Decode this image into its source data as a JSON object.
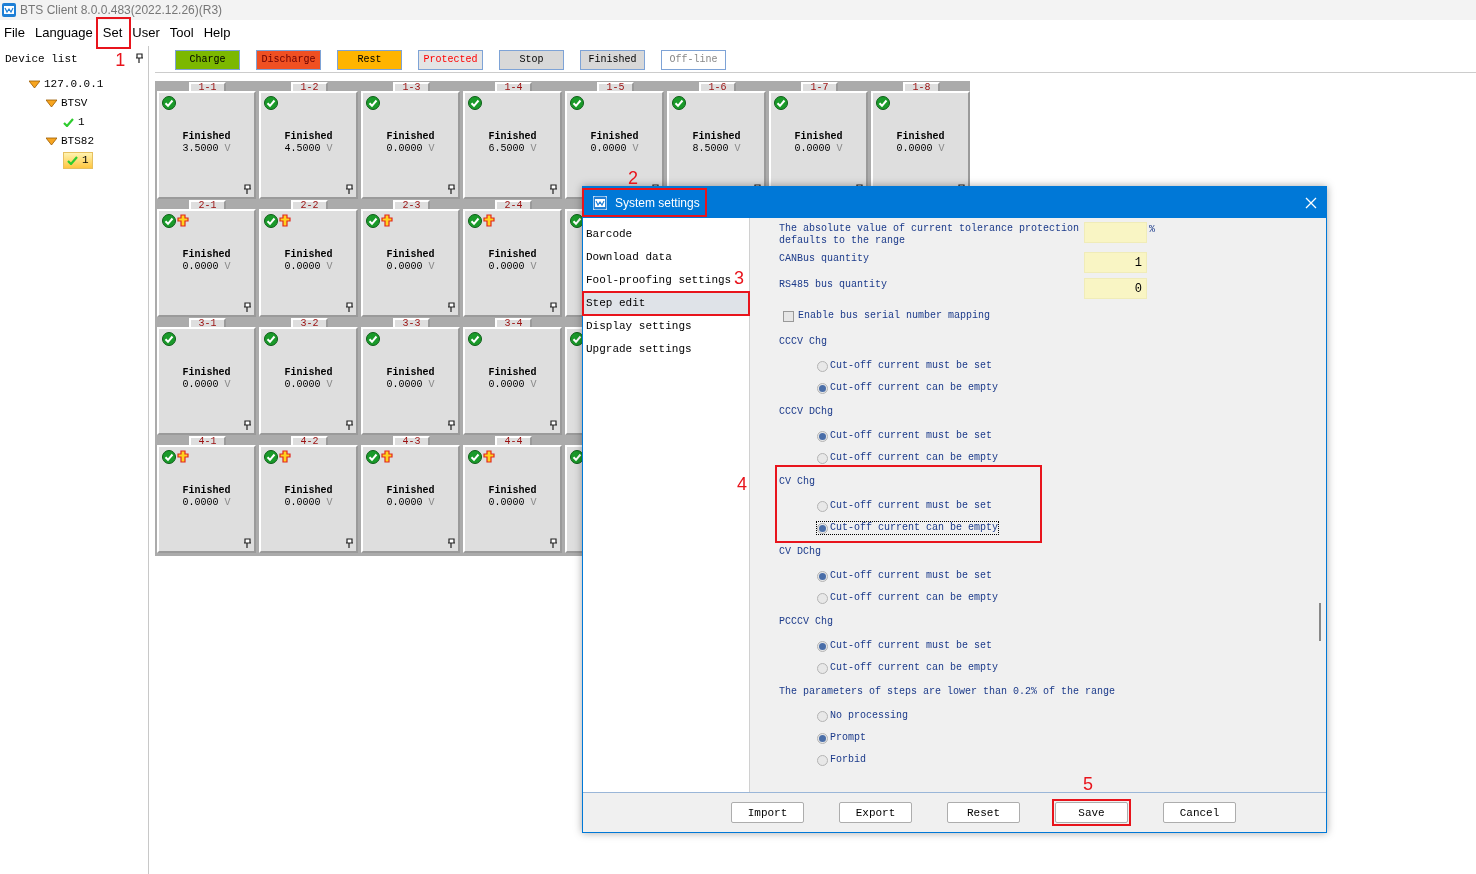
{
  "window": {
    "title": "BTS Client 8.0.0.483(2022.12.26)(R3)"
  },
  "menu": [
    {
      "label": "File"
    },
    {
      "label": "Language"
    },
    {
      "label": "Set"
    },
    {
      "label": "User"
    },
    {
      "label": "Tool"
    },
    {
      "label": "Help"
    }
  ],
  "device_list": {
    "title": "Device list",
    "tree": [
      {
        "label": "127.0.0.1",
        "expanded": true,
        "children": [
          {
            "label": "BTSV",
            "expanded": true,
            "children": [
              {
                "label": "1",
                "selected": false
              }
            ]
          },
          {
            "label": "BTS82",
            "expanded": true,
            "children": [
              {
                "label": "1",
                "selected": true
              }
            ]
          }
        ]
      }
    ]
  },
  "legend": [
    {
      "label": "Charge",
      "kind": "charge"
    },
    {
      "label": "Discharge",
      "kind": "discharge"
    },
    {
      "label": "Rest",
      "kind": "rest"
    },
    {
      "label": "Protected",
      "kind": "protected"
    },
    {
      "label": "Stop",
      "kind": "stop"
    },
    {
      "label": "Finished",
      "kind": "finished"
    },
    {
      "label": "Off-line",
      "kind": "offline"
    }
  ],
  "channel_rows": [
    {
      "cells": [
        {
          "label": "1-1",
          "status": "Finished",
          "voltage": "3.5000",
          "unit": "V",
          "protected": false
        },
        {
          "label": "1-2",
          "status": "Finished",
          "voltage": "4.5000",
          "unit": "V",
          "protected": false
        },
        {
          "label": "1-3",
          "status": "Finished",
          "voltage": "0.0000",
          "unit": "V",
          "protected": false
        },
        {
          "label": "1-4",
          "status": "Finished",
          "voltage": "6.5000",
          "unit": "V",
          "protected": false
        },
        {
          "label": "1-5",
          "status": "Finished",
          "voltage": "0.0000",
          "unit": "V",
          "protected": false
        },
        {
          "label": "1-6",
          "status": "Finished",
          "voltage": "8.5000",
          "unit": "V",
          "protected": false
        },
        {
          "label": "1-7",
          "status": "Finished",
          "voltage": "0.0000",
          "unit": "V",
          "protected": false
        },
        {
          "label": "1-8",
          "status": "Finished",
          "voltage": "0.0000",
          "unit": "V",
          "protected": false
        }
      ]
    },
    {
      "cells": [
        {
          "label": "2-1",
          "status": "Finished",
          "voltage": "0.0000",
          "unit": "V",
          "protected": true
        },
        {
          "label": "2-2",
          "status": "Finished",
          "voltage": "0.0000",
          "unit": "V",
          "protected": true
        },
        {
          "label": "2-3",
          "status": "Finished",
          "voltage": "0.0000",
          "unit": "V",
          "protected": true
        },
        {
          "label": "2-4",
          "status": "Finished",
          "voltage": "0.0000",
          "unit": "V",
          "protected": true
        }
      ]
    },
    {
      "cells": [
        {
          "label": "3-1",
          "status": "Finished",
          "voltage": "0.0000",
          "unit": "V",
          "protected": false
        },
        {
          "label": "3-2",
          "status": "Finished",
          "voltage": "0.0000",
          "unit": "V",
          "protected": false
        },
        {
          "label": "3-3",
          "status": "Finished",
          "voltage": "0.0000",
          "unit": "V",
          "protected": false
        },
        {
          "label": "3-4",
          "status": "Finished",
          "voltage": "0.0000",
          "unit": "V",
          "protected": false
        }
      ]
    },
    {
      "cells": [
        {
          "label": "4-1",
          "status": "Finished",
          "voltage": "0.0000",
          "unit": "V",
          "protected": true
        },
        {
          "label": "4-2",
          "status": "Finished",
          "voltage": "0.0000",
          "unit": "V",
          "protected": true
        },
        {
          "label": "4-3",
          "status": "Finished",
          "voltage": "0.0000",
          "unit": "V",
          "protected": true
        },
        {
          "label": "4-4",
          "status": "Finished",
          "voltage": "0.0000",
          "unit": "V",
          "protected": true
        }
      ]
    }
  ],
  "dialog": {
    "title": "System settings",
    "nav": [
      {
        "label": "Barcode",
        "selected": false
      },
      {
        "label": "Download data",
        "selected": false
      },
      {
        "label": "Fool-proofing settings",
        "selected": false
      },
      {
        "label": "Step edit",
        "selected": true
      },
      {
        "label": "Display settings",
        "selected": false
      },
      {
        "label": "Upgrade settings",
        "selected": false
      }
    ],
    "settings": [
      {
        "kind": "field",
        "label": "The absolute value of current tolerance protection defaults to the range",
        "unit": "%"
      },
      {
        "kind": "field",
        "label": "CANBus quantity",
        "value": "1"
      },
      {
        "kind": "field",
        "label": "RS485 bus quantity",
        "value": "0"
      },
      {
        "kind": "checkbox",
        "label": "Enable bus serial number mapping",
        "checked": false
      },
      {
        "kind": "radios",
        "label": "CCCV Chg",
        "options": [
          {
            "label": "Cut-off current must be set",
            "selected": false,
            "focused": false
          },
          {
            "label": "Cut-off current can be empty",
            "selected": true,
            "focused": false
          }
        ]
      },
      {
        "kind": "radios",
        "label": "CCCV DChg",
        "options": [
          {
            "label": "Cut-off current must be set",
            "selected": true,
            "focused": false
          },
          {
            "label": "Cut-off current can be empty",
            "selected": false,
            "focused": false
          }
        ]
      },
      {
        "kind": "radios",
        "label": "CV Chg",
        "options": [
          {
            "label": "Cut-off current must be set",
            "selected": false,
            "focused": false
          },
          {
            "label": "Cut-off current can be empty",
            "selected": true,
            "focused": true
          }
        ]
      },
      {
        "kind": "radios",
        "label": "CV DChg",
        "options": [
          {
            "label": "Cut-off current must be set",
            "selected": true,
            "focused": false
          },
          {
            "label": "Cut-off current can be empty",
            "selected": false,
            "focused": false
          }
        ]
      },
      {
        "kind": "radios",
        "label": "PCCCV Chg",
        "options": [
          {
            "label": "Cut-off current must be set",
            "selected": true,
            "focused": false
          },
          {
            "label": "Cut-off current can be empty",
            "selected": false,
            "focused": false
          }
        ]
      },
      {
        "kind": "radios",
        "label": "The parameters of steps are lower than 0.2% of the range",
        "options": [
          {
            "label": "No processing",
            "selected": false,
            "focused": false
          },
          {
            "label": "Prompt",
            "selected": true,
            "focused": false
          },
          {
            "label": "Forbid",
            "selected": false,
            "focused": false
          }
        ]
      }
    ],
    "buttons": [
      {
        "label": "Import"
      },
      {
        "label": "Export"
      },
      {
        "label": "Reset"
      },
      {
        "label": "Save"
      },
      {
        "label": "Cancel"
      }
    ]
  },
  "annotations": [
    {
      "label": "1"
    },
    {
      "label": "2"
    },
    {
      "label": "3"
    },
    {
      "label": "4"
    },
    {
      "label": "5"
    }
  ]
}
